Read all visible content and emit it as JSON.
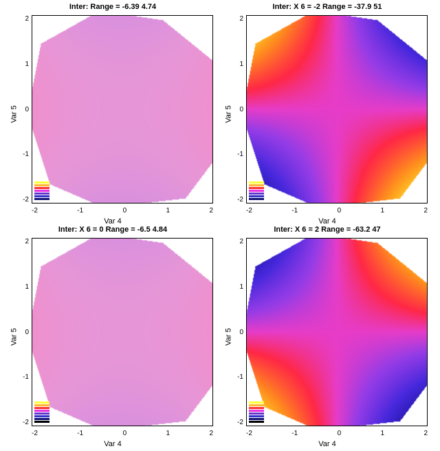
{
  "chart_data": [
    {
      "type": "heatmap",
      "title": "Inter:    Range = -6.39   4.74",
      "xlabel": "Var 4",
      "ylabel": "Var 5",
      "x_ticks": [
        "-2",
        "-1",
        "0",
        "1",
        "2"
      ],
      "y_ticks": [
        "2",
        "1",
        "0",
        "-1",
        "-2"
      ],
      "xlim": [
        -2,
        2
      ],
      "ylim": [
        -2,
        2
      ],
      "range": [
        -6.39,
        4.74
      ],
      "condition": null,
      "field": "flat",
      "palette": "soft",
      "legend_colors": [
        "#ffff33",
        "#ffb733",
        "#ff3333",
        "#e633e6",
        "#6633cc",
        "#3333cc",
        "#111177"
      ]
    },
    {
      "type": "heatmap",
      "title": "Inter:   X 6 = -2    Range = -37.9   51",
      "xlabel": "Var 4",
      "ylabel": "Var 5",
      "x_ticks": [
        "-2",
        "-1",
        "0",
        "1",
        "2"
      ],
      "y_ticks": [
        "2",
        "1",
        "0",
        "-1",
        "-2"
      ],
      "xlim": [
        -2,
        2
      ],
      "ylim": [
        -2,
        2
      ],
      "range": [
        -37.9,
        51
      ],
      "condition": {
        "var": "X6",
        "value": -2
      },
      "field": "saddle",
      "sign": -1,
      "palette": "vivid",
      "legend_colors": [
        "#ffff33",
        "#ffb733",
        "#ff3333",
        "#e633e6",
        "#6633cc",
        "#3333cc",
        "#111177"
      ]
    },
    {
      "type": "heatmap",
      "title": "Inter:   X 6 = 0    Range = -6.5   4.84",
      "xlabel": "Var 4",
      "ylabel": "Var 5",
      "x_ticks": [
        "-2",
        "-1",
        "0",
        "1",
        "2"
      ],
      "y_ticks": [
        "2",
        "1",
        "0",
        "-1",
        "-2"
      ],
      "xlim": [
        -2,
        2
      ],
      "ylim": [
        -2,
        2
      ],
      "range": [
        -6.5,
        4.84
      ],
      "condition": {
        "var": "X6",
        "value": 0
      },
      "field": "flat",
      "palette": "soft",
      "legend_colors": [
        "#ffff33",
        "#ffb733",
        "#ff3333",
        "#e633e6",
        "#6633cc",
        "#3333cc",
        "#111177",
        "#000000"
      ]
    },
    {
      "type": "heatmap",
      "title": "Inter:   X 6 = 2    Range = -63.2   47",
      "xlabel": "Var 4",
      "ylabel": "Var 5",
      "x_ticks": [
        "-2",
        "-1",
        "0",
        "1",
        "2"
      ],
      "y_ticks": [
        "2",
        "1",
        "0",
        "-1",
        "-2"
      ],
      "xlim": [
        -2,
        2
      ],
      "ylim": [
        -2,
        2
      ],
      "range": [
        -63.2,
        47
      ],
      "condition": {
        "var": "X6",
        "value": 2
      },
      "field": "saddle",
      "sign": 1,
      "palette": "vivid",
      "legend_colors": [
        "#ffff33",
        "#ffb733",
        "#ff3333",
        "#e633e6",
        "#6633cc",
        "#3333cc",
        "#111177",
        "#000000"
      ]
    }
  ],
  "convex_hull": [
    [
      -0.5,
      2.1
    ],
    [
      0.9,
      1.9
    ],
    [
      2.05,
      1.0
    ],
    [
      2.1,
      -1.0
    ],
    [
      1.4,
      -1.9
    ],
    [
      -0.4,
      -2.1
    ],
    [
      -1.6,
      -1.6
    ],
    [
      -2.1,
      -0.1
    ],
    [
      -1.8,
      1.4
    ]
  ]
}
